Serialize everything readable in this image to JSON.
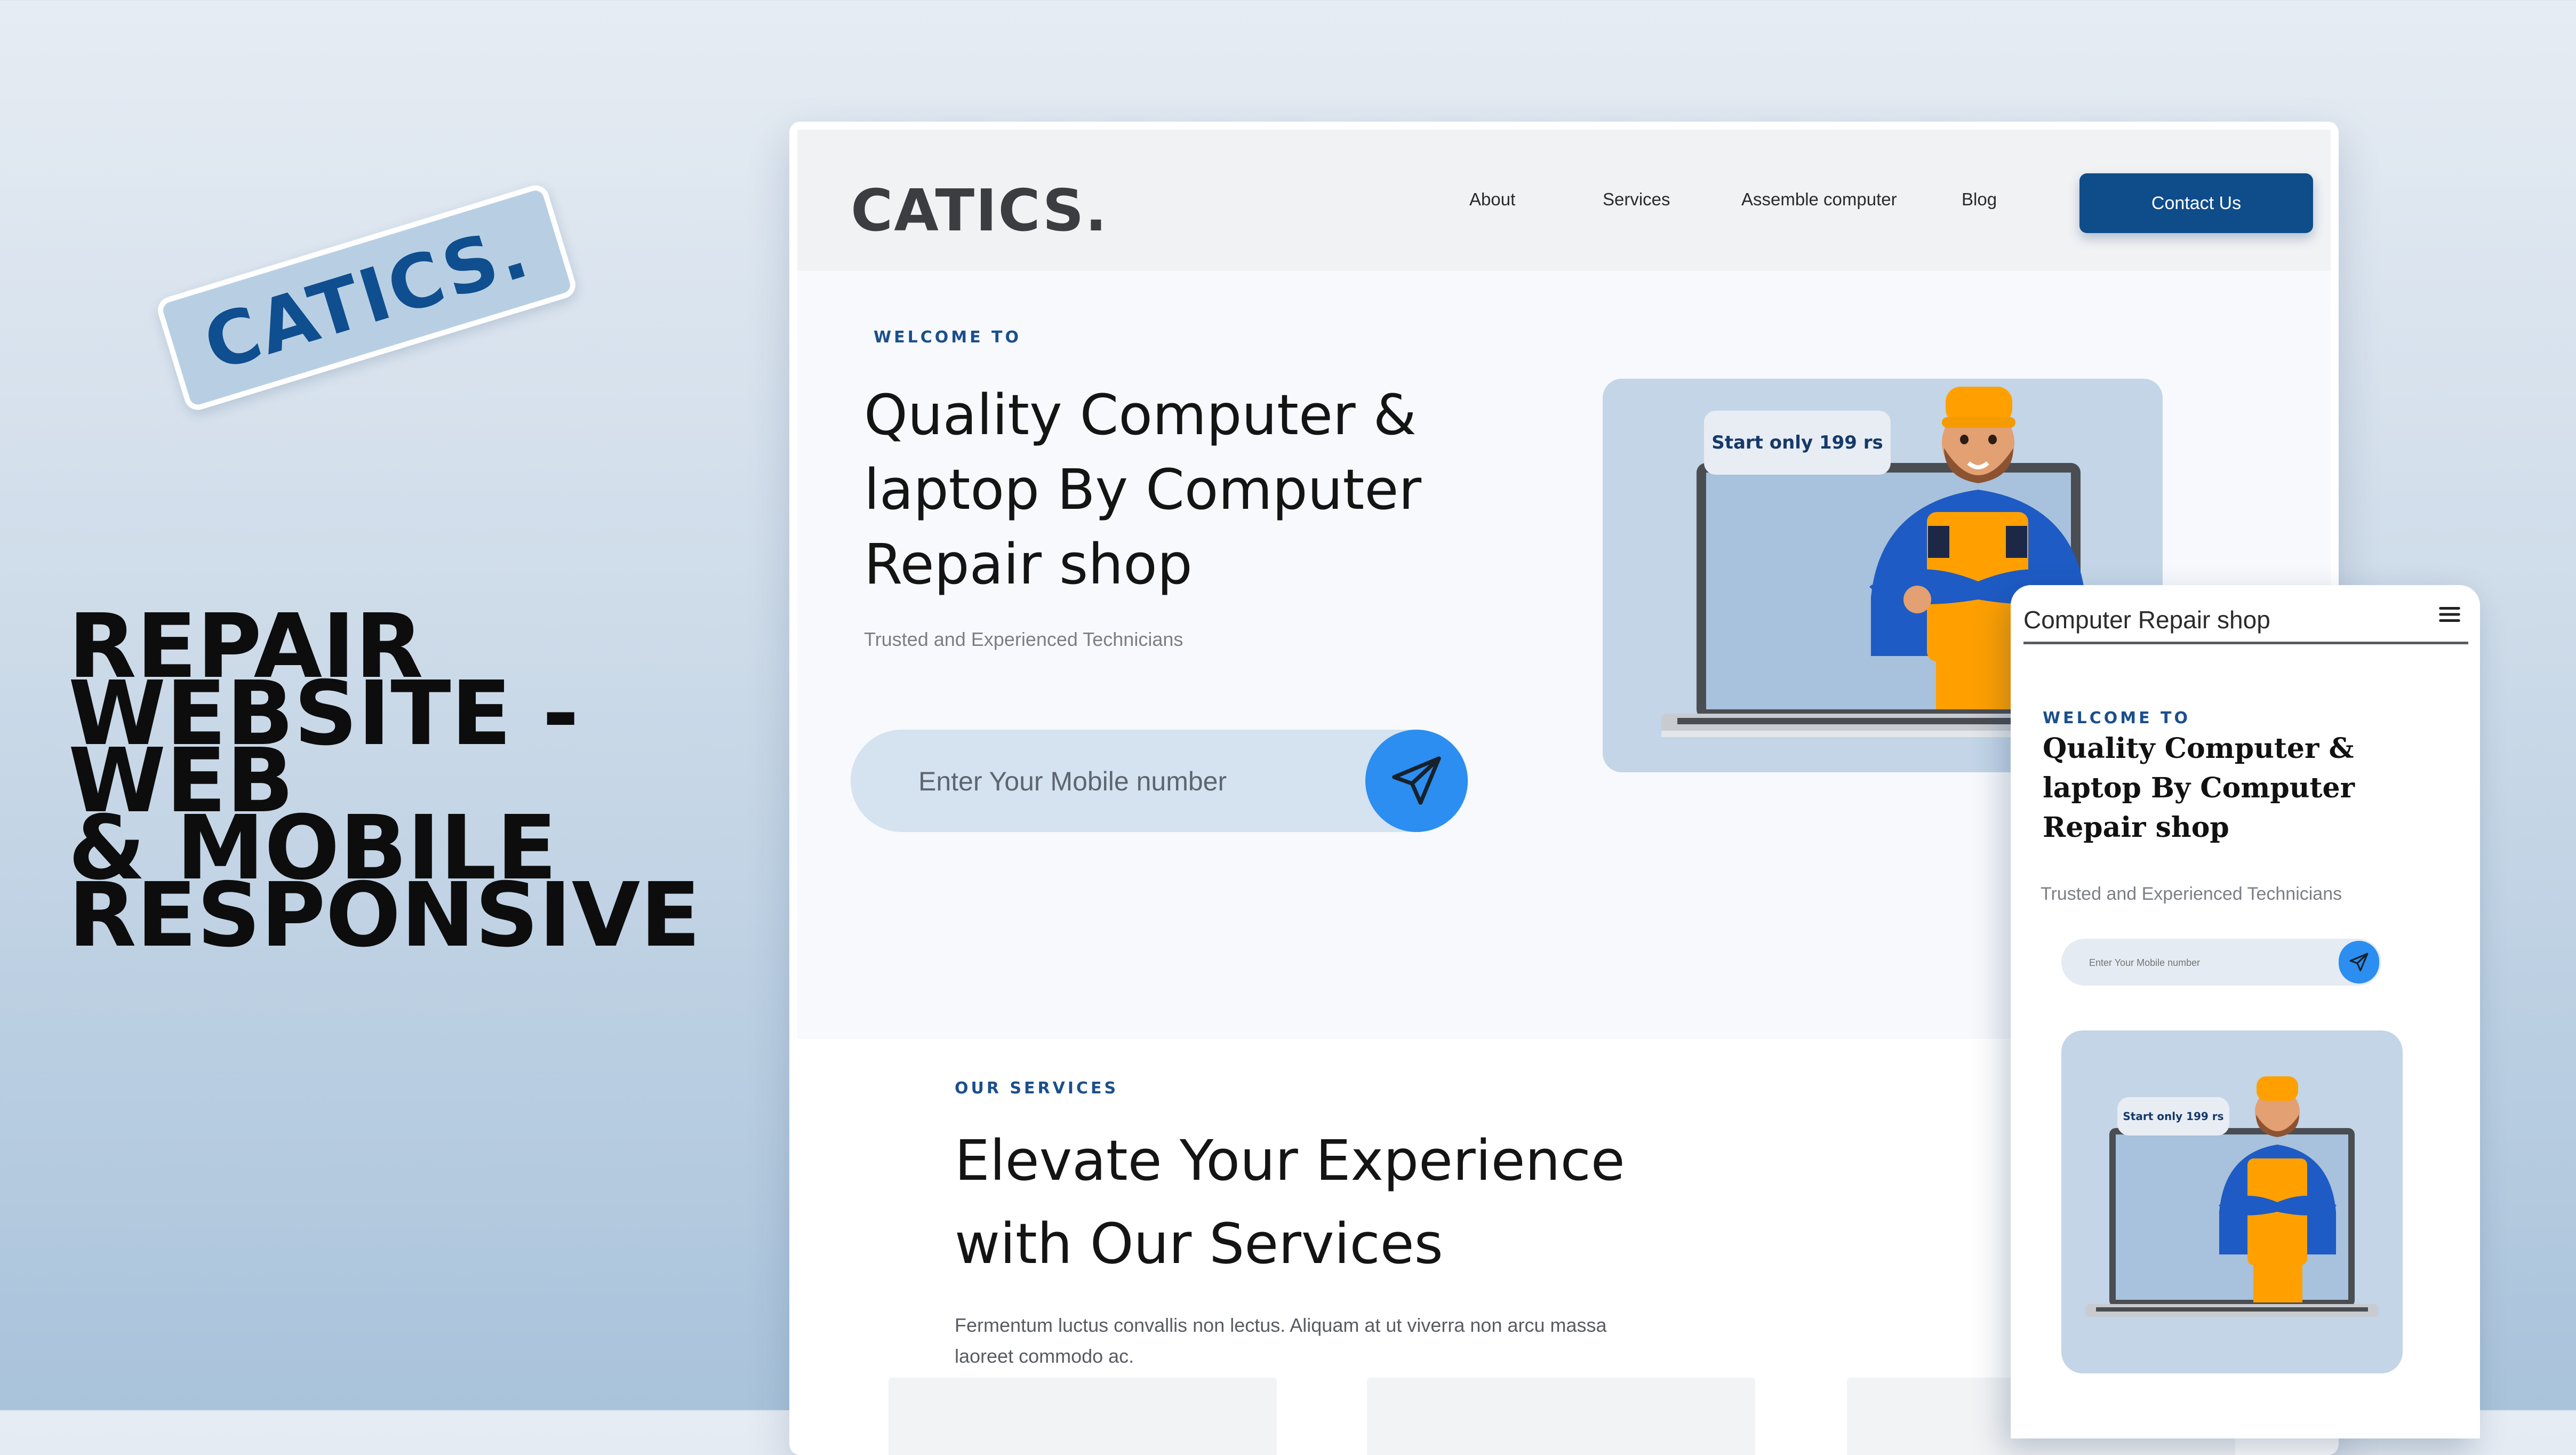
{
  "promo": {
    "badge_text": "CATICS.",
    "headline_lines": [
      "REPAIR",
      "WEBSITE - WEB",
      "& MOBILE",
      "RESPONSIVE"
    ]
  },
  "desktop": {
    "logo": "CATICS.",
    "nav": [
      "About",
      "Services",
      "Assemble computer",
      "Blog"
    ],
    "cta": "Contact Us",
    "hero": {
      "eyebrow": "WELCOME TO",
      "title_lines": [
        "Quality Computer &",
        "laptop By Computer",
        "Repair shop"
      ],
      "subtitle": "Trusted and Experienced Technicians",
      "input_placeholder": "Enter Your Mobile number",
      "send_icon": "paper-plane-icon",
      "bubble": "Start only 199 rs"
    },
    "services": {
      "eyebrow": "OUR SERVICES",
      "title_lines": [
        "Elevate Your Experience",
        "with Our Services"
      ],
      "description": "Fermentum luctus convallis non lectus. Aliquam at ut viverra non arcu massa laoreet commodo ac."
    }
  },
  "mobile": {
    "title": "Computer Repair shop",
    "menu_icon": "hamburger-menu-icon",
    "hero": {
      "eyebrow": "WELCOME TO",
      "title_lines": [
        "Quality Computer &",
        "laptop By Computer",
        "Repair shop"
      ],
      "subtitle": "Trusted and Experienced Technicians",
      "input_placeholder": "Enter Your Mobile number",
      "bubble": "Start only 199 rs"
    }
  },
  "colors": {
    "brand_blue": "#0f4c8a",
    "accent_blue": "#2b8ef0",
    "card_blue": "#c3d5e7"
  }
}
